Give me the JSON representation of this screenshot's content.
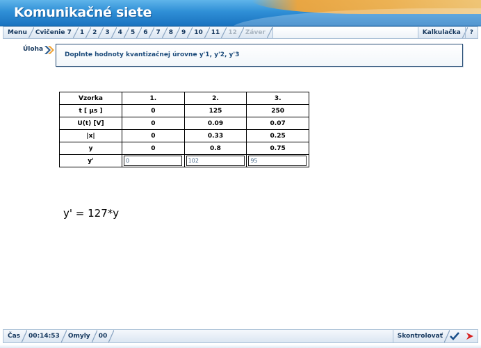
{
  "app": {
    "title": "Komunikačné siete"
  },
  "tabs": [
    {
      "label": "Menu",
      "disabled": false
    },
    {
      "label": "Cvičenie 7",
      "disabled": false
    },
    {
      "label": "1",
      "disabled": false
    },
    {
      "label": "2",
      "disabled": false
    },
    {
      "label": "3",
      "disabled": false
    },
    {
      "label": "4",
      "disabled": false
    },
    {
      "label": "5",
      "disabled": false
    },
    {
      "label": "6",
      "disabled": false
    },
    {
      "label": "7",
      "disabled": false
    },
    {
      "label": "8",
      "disabled": false
    },
    {
      "label": "9",
      "disabled": false
    },
    {
      "label": "10",
      "disabled": false
    },
    {
      "label": "11",
      "disabled": false
    },
    {
      "label": "12",
      "disabled": true
    },
    {
      "label": "Záver",
      "disabled": true
    }
  ],
  "right_tabs": {
    "calculator": "Kalkulačka",
    "help": "?"
  },
  "task": {
    "label": "Úloha",
    "text": "Doplnte hodnoty kvantizačnej úrovne y'1, y'2, y'3"
  },
  "table": {
    "header": [
      "Vzorka",
      "1.",
      "2.",
      "3."
    ],
    "rows": [
      [
        "t [ µs ]",
        "0",
        "125",
        "250"
      ],
      [
        "U(t) [V]",
        "0",
        "0.09",
        "0.07"
      ],
      [
        "|x|",
        "0",
        "0.33",
        "0.25"
      ],
      [
        "y",
        "0",
        "0.8",
        "0.75"
      ]
    ],
    "input_row_label": "y'",
    "inputs": [
      "0",
      "102",
      "95"
    ]
  },
  "formula": "y' = 127*y",
  "bottom": {
    "time_label": "Čas",
    "time_value": "00:14:53",
    "errors_label": "Omyly",
    "errors_value": "00",
    "check_label": "Skontrolovať"
  },
  "colors": {
    "title_bar": "#2f8fd6",
    "accent_orange": "#f0a53a",
    "nav_text": "#14365c",
    "task_text": "#1b4a7a",
    "next_arrow": "#d62020",
    "check_mark": "#1a4f8a"
  },
  "icons": {
    "task_arrow": "double-chevron-right-icon",
    "check": "checkmark-icon",
    "next": "red-arrow-right-icon"
  }
}
